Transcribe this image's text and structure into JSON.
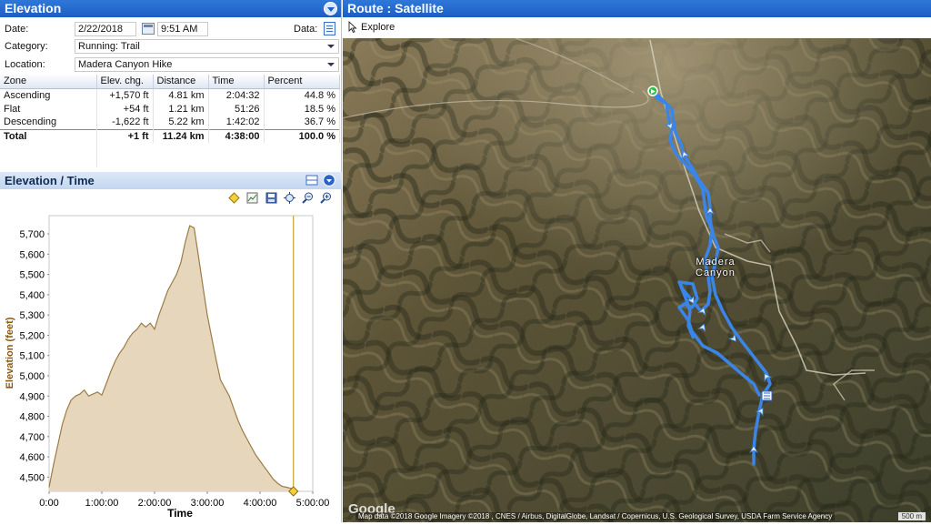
{
  "elevation_pane": {
    "title": "Elevation",
    "date_label": "Date:",
    "date_value": "2/22/2018",
    "time_value": "9:51 AM",
    "data_label": "Data:",
    "category_label": "Category:",
    "category_value": "Running: Trail",
    "location_label": "Location:",
    "location_value": "Madera Canyon Hike",
    "table": {
      "headers": [
        "Zone",
        "Elev. chg.",
        "Distance",
        "Time",
        "Percent"
      ],
      "rows": [
        [
          "Ascending",
          "+1,570 ft",
          "4.81 km",
          "2:04:32",
          "44.8 %"
        ],
        [
          "Flat",
          "+54 ft",
          "1.21 km",
          "51:26",
          "18.5 %"
        ],
        [
          "Descending",
          "-1,622 ft",
          "5.22 km",
          "1:42:02",
          "36.7 %"
        ]
      ],
      "total": [
        "Total",
        "+1 ft",
        "11.24 km",
        "4:38:00",
        "100.0 %"
      ]
    }
  },
  "chart_pane": {
    "title": "Elevation / Time"
  },
  "chart_data": {
    "type": "area",
    "xlabel": "Time",
    "ylabel": "Elevation (feet)",
    "x_ticks": [
      "0:00",
      "1:00:00",
      "2:00:00",
      "3:00:00",
      "4:00:00",
      "5:00:00"
    ],
    "y_ticks": [
      "4,500",
      "4,600",
      "4,700",
      "4,800",
      "4,900",
      "5,000",
      "5,100",
      "5,200",
      "5,300",
      "5,400",
      "5,500",
      "5,600",
      "5,700"
    ],
    "xlim_minutes": [
      0,
      300
    ],
    "ylim": [
      4430,
      5790
    ],
    "x_minutes": [
      0,
      5,
      10,
      15,
      20,
      25,
      30,
      35,
      40,
      45,
      50,
      55,
      60,
      65,
      70,
      75,
      80,
      85,
      90,
      95,
      100,
      105,
      110,
      115,
      120,
      125,
      130,
      135,
      140,
      145,
      150,
      155,
      160,
      165,
      170,
      175,
      180,
      185,
      190,
      195,
      200,
      205,
      210,
      215,
      220,
      225,
      230,
      235,
      240,
      245,
      250,
      255,
      260,
      265,
      270,
      275,
      278
    ],
    "y_feet": [
      4450,
      4560,
      4660,
      4760,
      4830,
      4880,
      4900,
      4910,
      4930,
      4900,
      4910,
      4920,
      4905,
      4960,
      5020,
      5070,
      5110,
      5140,
      5180,
      5210,
      5230,
      5260,
      5240,
      5260,
      5230,
      5300,
      5360,
      5420,
      5460,
      5500,
      5560,
      5660,
      5740,
      5730,
      5590,
      5440,
      5300,
      5190,
      5080,
      4980,
      4940,
      4900,
      4840,
      4780,
      4730,
      4690,
      4650,
      4610,
      4580,
      4550,
      4520,
      4490,
      4470,
      4455,
      4450,
      4445,
      4445
    ],
    "marker_minutes": 278,
    "fill_color": "#e6d6bb",
    "line_color": "#9c7b45",
    "marker_color": "#c8a02a"
  },
  "route_pane": {
    "title": "Route : Satellite",
    "explore_label": "Explore",
    "place_label": "Madera\nCanyon",
    "attribution": "Map data ©2018 Google Imagery ©2018 , CNES / Airbus, DigitalGlobe, Landsat / Copernicus, U.S. Geological Survey, USDA Farm Service Agency",
    "google_logo": "Google",
    "scale_label": "500 m",
    "route_color": "#3a86e8"
  }
}
